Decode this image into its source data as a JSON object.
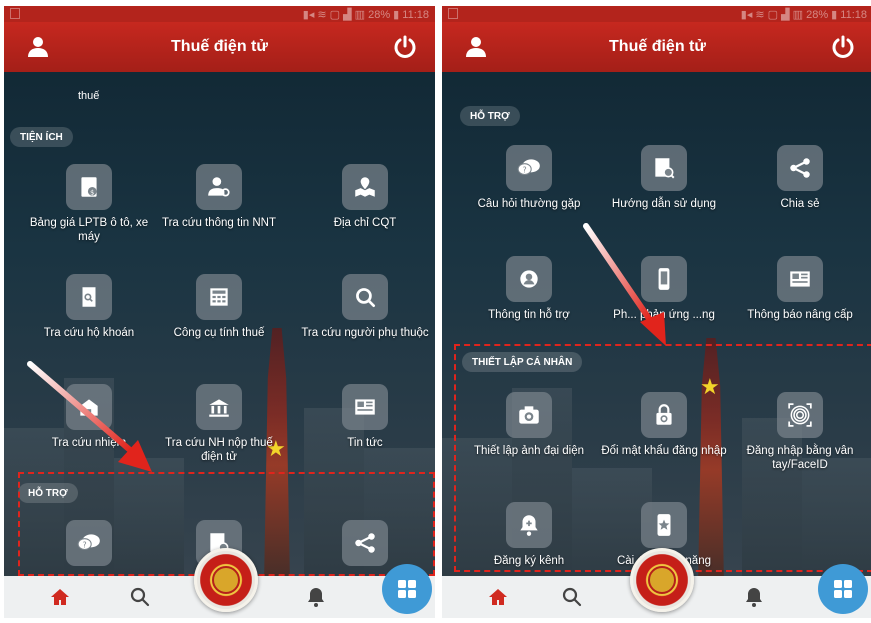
{
  "left": {
    "app_title": "Thuế điện tử",
    "cut_label": "thuế",
    "section_utilities": "TIỆN ÍCH",
    "section_support": "HỖ TRỢ",
    "utilities": [
      {
        "label": "Bảng giá LPTB ô tô, xe máy",
        "icon": "price-list-icon"
      },
      {
        "label": "Tra cứu thông tin NNT",
        "icon": "taxpayer-search-icon"
      },
      {
        "label": "Địa chỉ CQT",
        "icon": "map-location-icon"
      },
      {
        "label": "Tra cứu hộ khoán",
        "icon": "household-search-icon"
      },
      {
        "label": "Công cụ tính thuế",
        "icon": "calculator-icon"
      },
      {
        "label": "Tra cứu người phụ thuộc",
        "icon": "search-magnifier-icon"
      },
      {
        "label": "Tra cứu nhiệm",
        "icon": "obligation-search-icon"
      },
      {
        "label": "Tra cứu NH nộp thuế điện tử",
        "icon": "bank-icon"
      },
      {
        "label": "Tin tức",
        "icon": "news-icon"
      }
    ],
    "support_icons": [
      "chat-question-icon",
      "guide-doc-icon",
      "share-icon"
    ]
  },
  "right": {
    "app_title": "Thuế điện tử",
    "section_support": "HỖ TRỢ",
    "section_personal": "THIẾT LẬP CÁ NHÂN",
    "support": [
      {
        "label": "Câu hỏi thường gặp",
        "icon": "chat-question-icon"
      },
      {
        "label": "Hướng dẫn sử dụng",
        "icon": "guide-doc-icon"
      },
      {
        "label": "Chia sẻ",
        "icon": "share-icon"
      },
      {
        "label": "Thông tin hỗ trợ",
        "icon": "support-info-icon"
      },
      {
        "label": "Ph... phản ứng ...ng",
        "icon": "phone-feedback-icon"
      },
      {
        "label": "Thông báo nâng cấp",
        "icon": "upgrade-notice-icon"
      }
    ],
    "personal": [
      {
        "label": "Thiết lập ảnh đại diện",
        "icon": "camera-icon"
      },
      {
        "label": "Đổi mật khẩu đăng nhập",
        "icon": "lock-reset-icon"
      },
      {
        "label": "Đăng nhập bằng vân tay/FaceID",
        "icon": "fingerprint-icon"
      },
      {
        "label": "Đăng ký kênh",
        "icon": "bell-subscribe-icon"
      },
      {
        "label": "Cài đặt chức năng",
        "icon": "settings-phone-icon"
      }
    ]
  },
  "nav": {
    "items": [
      "home-icon",
      "search-icon",
      "tax-emblem-icon",
      "notification-icon",
      "menu-grid-icon"
    ]
  },
  "colors": {
    "appbar_red": "#b3241c",
    "highlight_red": "#e0241c",
    "fab_blue": "#3f9ad6"
  }
}
